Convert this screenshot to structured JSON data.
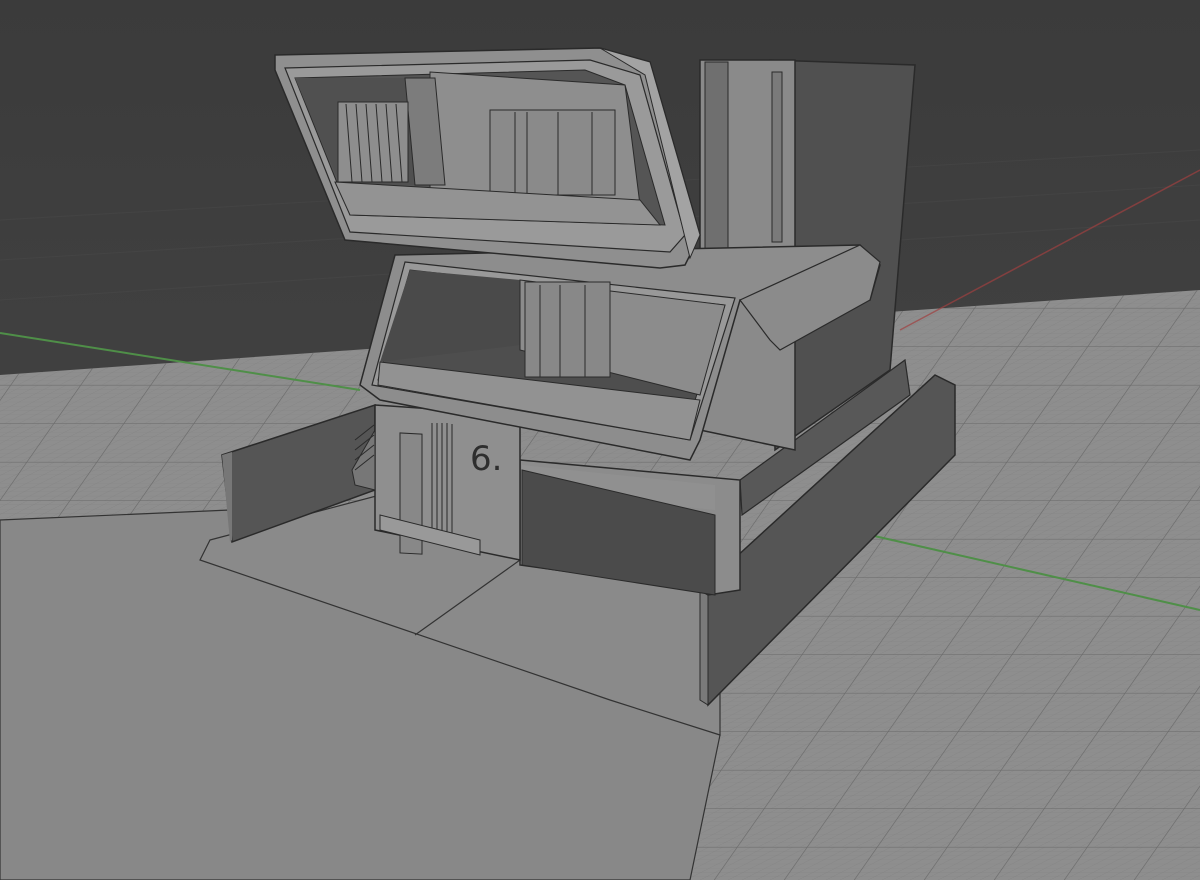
{
  "viewport": {
    "name": "3D Viewport",
    "background_color": "#3d3d3d",
    "floor_grid_color": "#8a8a8a",
    "x_axis_color": "#a04040",
    "y_axis_color": "#4f8f48",
    "grid": true
  },
  "model": {
    "description_icon": "house-model",
    "house_number": "6.",
    "base_color": "#8e8e8e",
    "shadow_color": "#555555",
    "edge_color": "#2a2a2a"
  }
}
